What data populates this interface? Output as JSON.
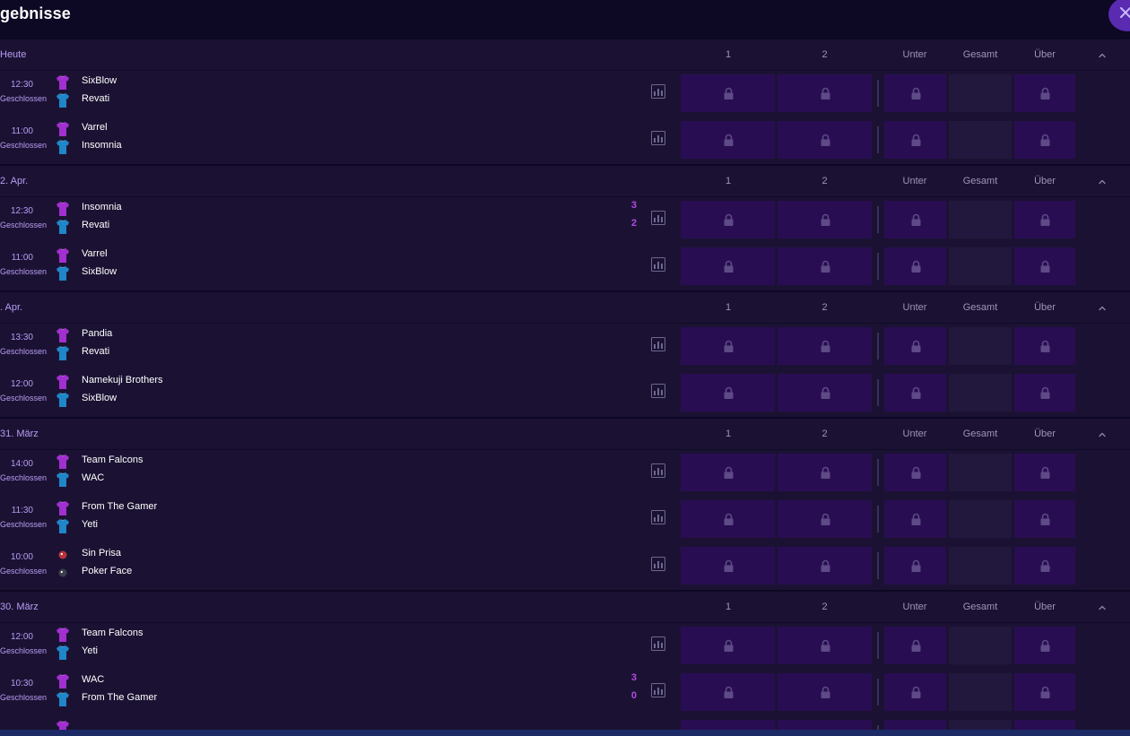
{
  "header": {
    "title": "gebnisse",
    "close_icon": "close-icon"
  },
  "columns": {
    "c1": "1",
    "c2": "2",
    "under": "Unter",
    "total": "Gesamt",
    "over": "Über"
  },
  "colors": {
    "background": "#1b1233",
    "odds_cell": "#290d52",
    "accent": "#b04ae6",
    "muted_text": "#b79cf2",
    "home_jersey": "#a22fcf",
    "away_jersey": "#1f86c8"
  },
  "days": [
    {
      "label": "Heute",
      "matches": [
        {
          "time": "12:30",
          "status": "Geschlossen",
          "team1": "SixBlow",
          "team2": "Revati",
          "score1": "",
          "score2": ""
        },
        {
          "time": "11:00",
          "status": "Geschlossen",
          "team1": "Varrel",
          "team2": "Insomnia",
          "score1": "",
          "score2": ""
        }
      ]
    },
    {
      "label": "2. Apr.",
      "matches": [
        {
          "time": "12:30",
          "status": "Geschlossen",
          "team1": "Insomnia",
          "team2": "Revati",
          "score1": "3",
          "score2": "2"
        },
        {
          "time": "11:00",
          "status": "Geschlossen",
          "team1": "Varrel",
          "team2": "SixBlow",
          "score1": "",
          "score2": ""
        }
      ]
    },
    {
      "label": ". Apr.",
      "matches": [
        {
          "time": "13:30",
          "status": "Geschlossen",
          "team1": "Pandia",
          "team2": "Revati",
          "score1": "",
          "score2": ""
        },
        {
          "time": "12:00",
          "status": "Geschlossen",
          "team1": "Namekuji Brothers",
          "team2": "SixBlow",
          "score1": "",
          "score2": ""
        }
      ]
    },
    {
      "label": "31. März",
      "matches": [
        {
          "time": "14:00",
          "status": "Geschlossen",
          "team1": "Team Falcons",
          "team2": "WAC",
          "score1": "",
          "score2": ""
        },
        {
          "time": "11:30",
          "status": "Geschlossen",
          "team1": "From The Gamer",
          "team2": "Yeti",
          "score1": "",
          "score2": ""
        },
        {
          "time": "10:00",
          "status": "Geschlossen",
          "team1": "Sin Prisa",
          "team2": "Poker Face",
          "score1": "",
          "score2": "",
          "logo_style": "badge"
        }
      ]
    },
    {
      "label": "30. März",
      "matches": [
        {
          "time": "12:00",
          "status": "Geschlossen",
          "team1": "Team Falcons",
          "team2": "Yeti",
          "score1": "",
          "score2": ""
        },
        {
          "time": "10:30",
          "status": "Geschlossen",
          "team1": "WAC",
          "team2": "From The Gamer",
          "score1": "3",
          "score2": "0"
        },
        {
          "time": "",
          "status": "",
          "team1": "",
          "team2": "",
          "score1": "",
          "score2": ""
        }
      ]
    }
  ]
}
